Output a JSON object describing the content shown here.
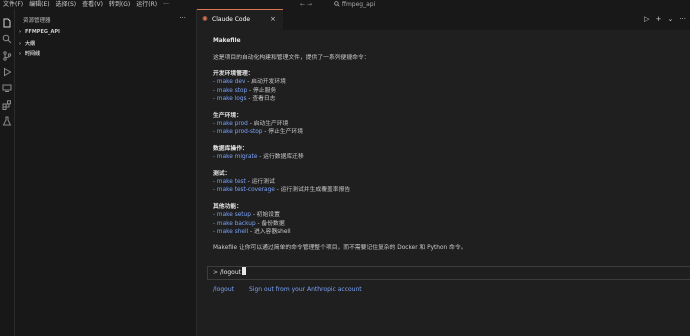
{
  "titlebar": {
    "menu": [
      "文件(F)",
      "编辑(E)",
      "选择(S)",
      "查看(V)",
      "转到(G)",
      "运行(R)",
      "···"
    ],
    "back": "←",
    "forward": "→",
    "search": "ffmpeg_api"
  },
  "sidebar": {
    "title": "资源管理器",
    "more": "···",
    "sections": [
      {
        "chevron": "›",
        "label": "FFMPEG_API"
      },
      {
        "chevron": "›",
        "label": "大纲"
      },
      {
        "chevron": "›",
        "label": "时间线"
      }
    ]
  },
  "tab": {
    "title": "Claude Code",
    "close": "×"
  },
  "editor_actions": {
    "run": "▷",
    "add": "+",
    "dropdown": "⌄",
    "more": "···"
  },
  "doc": {
    "title": "Makefile",
    "intro": "这是项目的自动化构建和管理文件，提供了一系列便捷命令：",
    "groups": [
      {
        "heading": "开发环境管理：",
        "items": [
          {
            "cmd": "- make dev",
            "desc": " - 启动开发环境"
          },
          {
            "cmd": "- make stop",
            "desc": " - 停止服务"
          },
          {
            "cmd": "- make logs",
            "desc": " - 查看日志"
          }
        ]
      },
      {
        "heading": "生产环境：",
        "items": [
          {
            "cmd": "- make prod",
            "desc": " - 启动生产环境"
          },
          {
            "cmd": "- make prod-stop",
            "desc": " - 停止生产环境"
          }
        ]
      },
      {
        "heading": "数据库操作：",
        "items": [
          {
            "cmd": "- make migrate",
            "desc": " - 运行数据库迁移"
          }
        ]
      },
      {
        "heading": "测试：",
        "items": [
          {
            "cmd": "- make test",
            "desc": " - 运行测试"
          },
          {
            "cmd": "- make test-coverage",
            "desc": " - 运行测试并生成覆盖率报告"
          }
        ]
      },
      {
        "heading": "其他功能：",
        "items": [
          {
            "cmd": "- make setup",
            "desc": " - 初始设置"
          },
          {
            "cmd": "- make backup",
            "desc": " - 备份数据"
          },
          {
            "cmd": "- make shell",
            "desc": " - 进入容器shell"
          }
        ]
      }
    ],
    "summary": "Makefile 让你可以通过简单的命令管理整个项目，而不需要记住复杂的 Docker 和 Python 命令。"
  },
  "input": {
    "prompt": ">",
    "value": "/logout"
  },
  "suggestion": {
    "command": "/logout",
    "description": "Sign out from your Anthropic account"
  },
  "colors": {
    "accent": "#d97757",
    "link": "#7aa2f7",
    "background": "#1f1f1f",
    "sidebar": "#181818"
  }
}
